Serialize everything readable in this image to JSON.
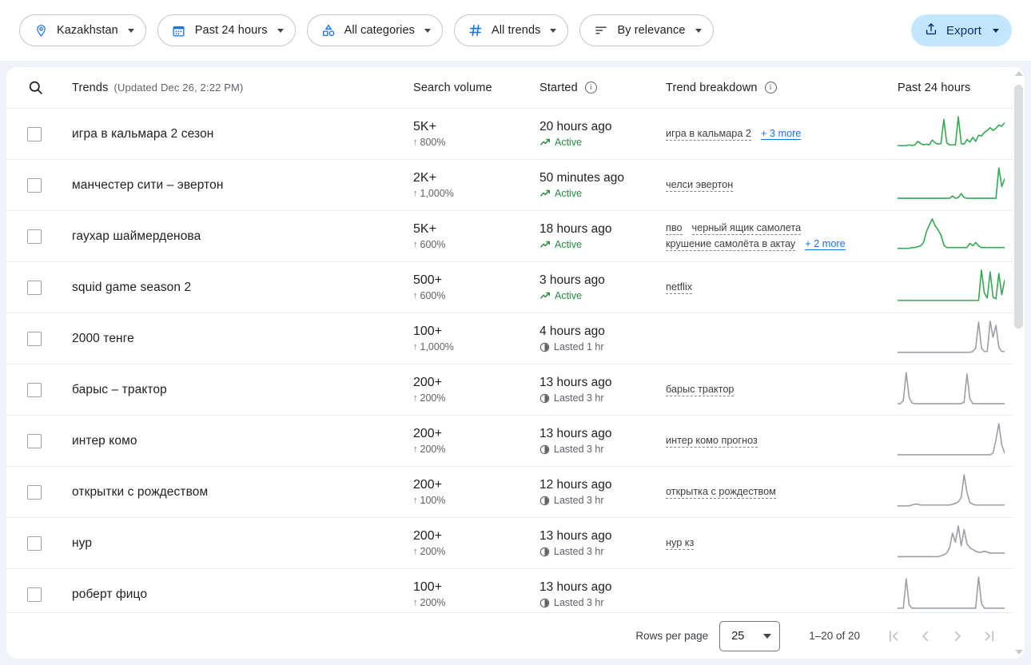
{
  "filters": [
    {
      "id": "location",
      "icon": "location-pin-icon",
      "label": "Kazakhstan"
    },
    {
      "id": "timerange",
      "icon": "calendar-icon",
      "label": "Past 24 hours"
    },
    {
      "id": "categories",
      "icon": "categories-icon",
      "label": "All categories"
    },
    {
      "id": "trendtype",
      "icon": "hash-icon",
      "label": "All trends"
    },
    {
      "id": "sort",
      "icon": "sort-icon",
      "label": "By relevance"
    }
  ],
  "export": {
    "label": "Export",
    "icon": "export-icon",
    "bg": "#c2e7ff",
    "fg": "#062e6f"
  },
  "table": {
    "search_icon": "search-icon",
    "columns": {
      "trends": "Trends",
      "updated": "(Updated Dec 26, 2:22 PM)",
      "search_volume": "Search volume",
      "started": "Started",
      "trend_breakdown": "Trend breakdown",
      "past_24_hours": "Past 24 hours"
    },
    "rows": [
      {
        "title": "игра в кальмара 2 сезон",
        "volume": "5K+",
        "growth": "800%",
        "growth_arrow": "↑",
        "started": "20 hours ago",
        "status": "Active",
        "status_type": "active",
        "terms": [
          "игра в кальмара 2"
        ],
        "more": "+ 3 more",
        "spark_color": "#34a853",
        "spark": [
          8,
          8,
          8,
          8,
          9,
          8,
          9,
          14,
          11,
          9,
          10,
          9,
          16,
          12,
          10,
          11,
          46,
          12,
          9,
          9,
          9,
          50,
          11,
          10,
          17,
          13,
          20,
          14,
          23,
          22,
          27,
          30,
          34,
          30,
          33,
          38,
          36,
          41
        ]
      },
      {
        "title": "манчестер сити – эвертон",
        "volume": "2K+",
        "growth": "1,000%",
        "growth_arrow": "↑",
        "started": "50 minutes ago",
        "status": "Active",
        "status_type": "active",
        "terms": [
          "челси эвертон"
        ],
        "more": "",
        "spark_color": "#34a853",
        "spark": [
          5,
          5,
          5,
          5,
          5,
          5,
          5,
          5,
          5,
          5,
          5,
          5,
          5,
          5,
          5,
          5,
          5,
          5,
          5,
          8,
          5,
          6,
          11,
          6,
          5,
          5,
          5,
          5,
          5,
          5,
          5,
          5,
          5,
          5,
          5,
          44,
          20,
          30
        ]
      },
      {
        "title": "гаухар шаймерденова",
        "volume": "5K+",
        "growth": "600%",
        "growth_arrow": "↑",
        "started": "18 hours ago",
        "status": "Active",
        "status_type": "active",
        "terms": [
          "пво",
          "черный ящик самолета",
          "крушение самолёта в актау"
        ],
        "more": "+ 2 more",
        "spark_color": "#34a853",
        "spark": [
          6,
          6,
          6,
          6,
          6,
          7,
          7,
          8,
          9,
          13,
          26,
          34,
          41,
          33,
          28,
          22,
          10,
          7,
          7,
          7,
          7,
          7,
          7,
          7,
          7,
          12,
          9,
          13,
          9,
          7,
          7,
          7,
          7,
          7,
          7,
          7,
          7,
          7
        ]
      },
      {
        "title": "squid game season 2",
        "volume": "500+",
        "growth": "600%",
        "growth_arrow": "↑",
        "started": "3 hours ago",
        "status": "Active",
        "status_type": "active",
        "terms": [
          "netflix"
        ],
        "more": "",
        "spark_color": "#34a853",
        "spark": [
          5,
          5,
          5,
          5,
          5,
          5,
          5,
          5,
          5,
          5,
          5,
          5,
          5,
          5,
          5,
          5,
          5,
          5,
          5,
          5,
          5,
          5,
          5,
          5,
          5,
          5,
          5,
          5,
          5,
          42,
          14,
          8,
          40,
          9,
          7,
          38,
          12,
          30
        ]
      },
      {
        "title": "2000 тенге",
        "volume": "100+",
        "growth": "1,000%",
        "growth_arrow": "↑",
        "started": "4 hours ago",
        "status": "Lasted 1 hr",
        "status_type": "ended",
        "terms": [],
        "more": "",
        "spark_color": "#9aa0a6",
        "spark": [
          4,
          4,
          4,
          4,
          4,
          4,
          4,
          4,
          4,
          4,
          4,
          4,
          4,
          4,
          4,
          4,
          4,
          4,
          4,
          4,
          4,
          4,
          4,
          4,
          4,
          4,
          5,
          9,
          40,
          9,
          5,
          5,
          41,
          22,
          36,
          10,
          5,
          5
        ]
      },
      {
        "title": "барыс – трактор",
        "volume": "200+",
        "growth": "200%",
        "growth_arrow": "↑",
        "started": "13 hours ago",
        "status": "Lasted 3 hr",
        "status_type": "ended",
        "terms": [
          "барыс трактор"
        ],
        "more": "",
        "spark_color": "#9aa0a6",
        "spark": [
          4,
          4,
          8,
          44,
          12,
          5,
          4,
          4,
          4,
          4,
          4,
          4,
          4,
          4,
          4,
          4,
          4,
          4,
          4,
          4,
          4,
          4,
          4,
          6,
          42,
          10,
          4,
          4,
          4,
          4,
          4,
          4,
          4,
          4,
          4,
          4,
          4,
          4
        ]
      },
      {
        "title": "интер комо",
        "volume": "200+",
        "growth": "200%",
        "growth_arrow": "↑",
        "started": "13 hours ago",
        "status": "Lasted 3 hr",
        "status_type": "ended",
        "terms": [
          "интер комо прогноз"
        ],
        "more": "",
        "spark_color": "#9aa0a6",
        "spark": [
          4,
          4,
          4,
          4,
          4,
          4,
          4,
          4,
          4,
          4,
          4,
          4,
          4,
          4,
          4,
          4,
          4,
          4,
          4,
          4,
          4,
          4,
          4,
          4,
          4,
          4,
          4,
          4,
          4,
          4,
          4,
          4,
          4,
          6,
          22,
          42,
          16,
          6
        ]
      },
      {
        "title": "открытки с рождеством",
        "volume": "200+",
        "growth": "100%",
        "growth_arrow": "↑",
        "started": "12 hours ago",
        "status": "Lasted 3 hr",
        "status_type": "ended",
        "terms": [
          "открытка с рождеством"
        ],
        "more": "",
        "spark_color": "#9aa0a6",
        "spark": [
          4,
          4,
          4,
          4,
          4,
          5,
          6,
          6,
          5,
          5,
          5,
          5,
          5,
          5,
          5,
          5,
          5,
          5,
          5,
          6,
          7,
          9,
          14,
          42,
          20,
          8,
          6,
          5,
          5,
          5,
          5,
          5,
          5,
          5,
          5,
          5,
          5,
          5
        ]
      },
      {
        "title": "нур",
        "volume": "200+",
        "growth": "200%",
        "growth_arrow": "↑",
        "started": "13 hours ago",
        "status": "Lasted 3 hr",
        "status_type": "ended",
        "terms": [
          "нур кз"
        ],
        "more": "",
        "spark_color": "#9aa0a6",
        "spark": [
          4,
          4,
          4,
          4,
          4,
          4,
          4,
          4,
          4,
          4,
          4,
          4,
          4,
          4,
          4,
          5,
          6,
          8,
          14,
          30,
          20,
          38,
          16,
          34,
          18,
          14,
          12,
          10,
          9,
          9,
          10,
          9,
          8,
          8,
          8,
          8,
          8,
          8
        ]
      },
      {
        "title": "роберт фицо",
        "volume": "100+",
        "growth": "200%",
        "growth_arrow": "↑",
        "started": "13 hours ago",
        "status": "Lasted 3 hr",
        "status_type": "ended",
        "terms": [],
        "more": "",
        "spark_color": "#9aa0a6",
        "spark": [
          4,
          4,
          4,
          40,
          8,
          4,
          4,
          4,
          4,
          4,
          4,
          4,
          4,
          4,
          4,
          4,
          4,
          4,
          4,
          4,
          4,
          4,
          4,
          4,
          4,
          4,
          4,
          4,
          42,
          10,
          4,
          4,
          4,
          4,
          4,
          4,
          4,
          4
        ]
      }
    ]
  },
  "footer": {
    "rows_per_page_label": "Rows per page",
    "rows_per_page_value": "25",
    "range": "1–20 of 20",
    "first_icon": "first-page-icon",
    "prev_icon": "previous-page-icon",
    "next_icon": "next-page-icon",
    "last_icon": "last-page-icon"
  }
}
